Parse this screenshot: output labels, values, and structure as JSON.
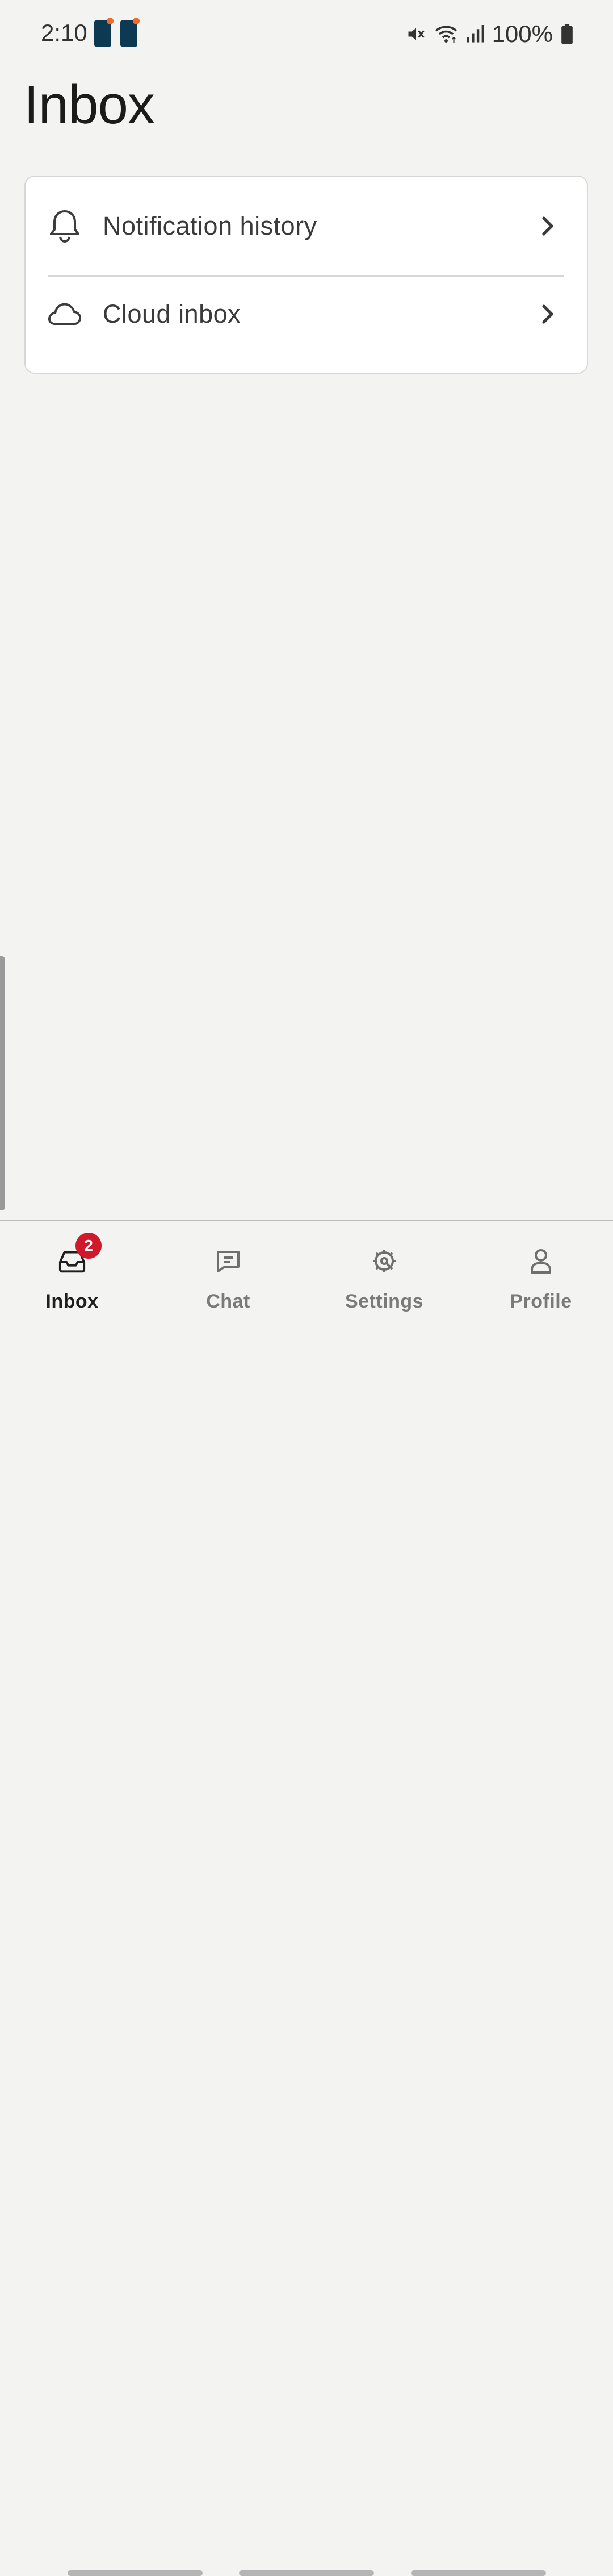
{
  "status_bar": {
    "time": "2:10",
    "battery": "100%",
    "icons": [
      "mute-icon",
      "wifi-icon",
      "signal-icon",
      "battery-icon"
    ]
  },
  "page": {
    "title": "Inbox"
  },
  "menu": {
    "items": [
      {
        "label": "Notification history",
        "icon": "bell-icon"
      },
      {
        "label": "Cloud inbox",
        "icon": "cloud-icon"
      }
    ]
  },
  "bottom_nav": {
    "items": [
      {
        "label": "Inbox",
        "icon": "inbox-icon",
        "active": true,
        "badge": "2"
      },
      {
        "label": "Chat",
        "icon": "chat-icon",
        "active": false
      },
      {
        "label": "Settings",
        "icon": "settings-icon",
        "active": false
      },
      {
        "label": "Profile",
        "icon": "profile-icon",
        "active": false
      }
    ]
  },
  "colors": {
    "background": "#f3f3f2",
    "badge": "#d0192d",
    "app_icon": "#0d3a52",
    "app_icon_dot": "#f06a2a"
  }
}
